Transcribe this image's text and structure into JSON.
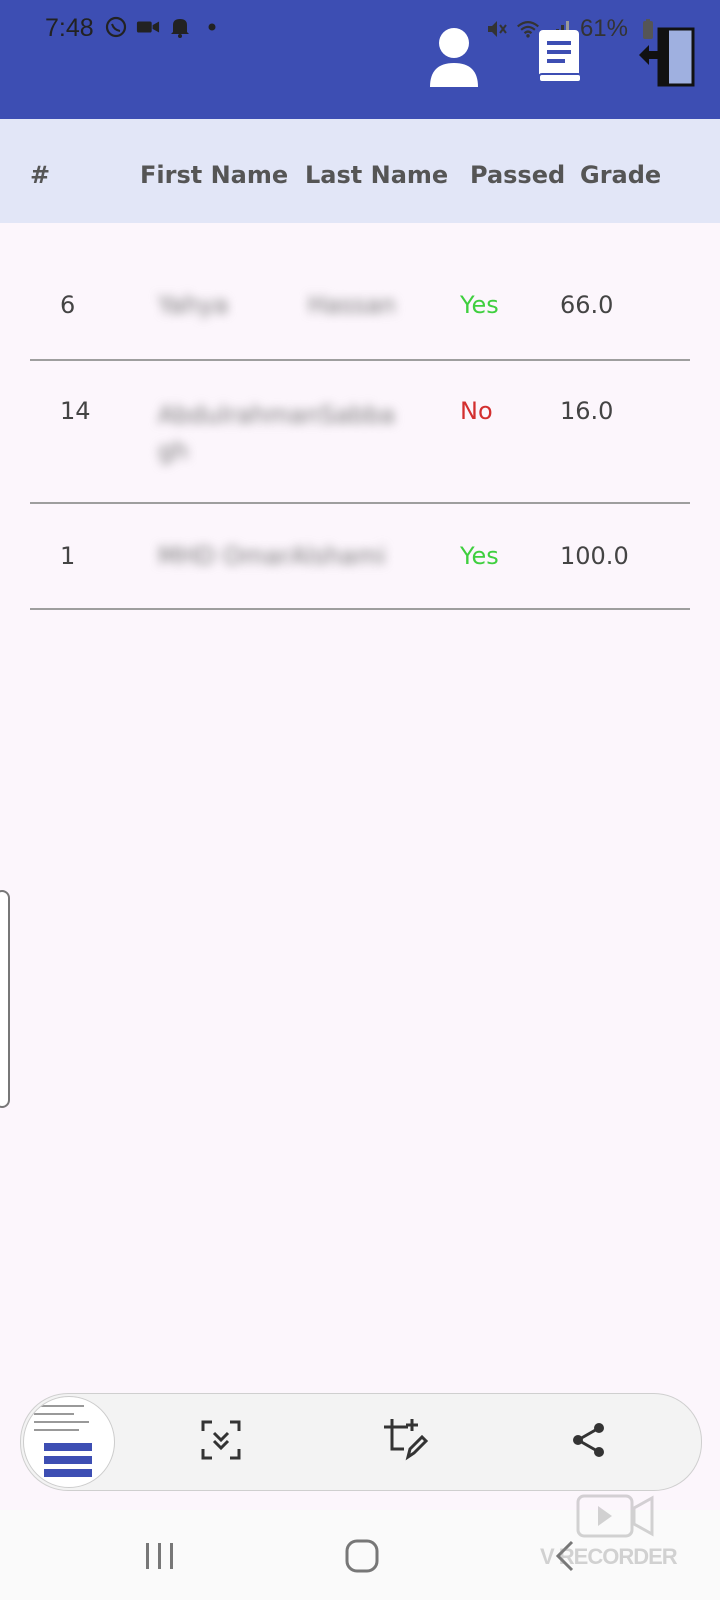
{
  "status_bar": {
    "time": "7:48",
    "battery": "61%"
  },
  "header": {
    "icons": [
      "person-icon",
      "book-icon",
      "logout-icon"
    ]
  },
  "table": {
    "columns": [
      "#",
      "First Name",
      "Last Name",
      "Passed",
      "Grade"
    ],
    "rows": [
      {
        "id": "6",
        "first_name": "Yahya",
        "last_name": "Hassan",
        "passed": "Yes",
        "grade": "66.0"
      },
      {
        "id": "14",
        "first_name": "Abdulrahman",
        "last_name": "Sabbagh",
        "passed": "No",
        "grade": "16.0"
      },
      {
        "id": "1",
        "first_name": "MHD Omar",
        "last_name": "Alshami",
        "passed": "Yes",
        "grade": "100.0"
      }
    ]
  },
  "screenshot_toolbar": {
    "buttons": [
      "scroll-capture-icon",
      "crop-edit-icon",
      "share-icon"
    ]
  },
  "watermark": {
    "text": "V RECORDER"
  },
  "colors": {
    "appbar": "#3d4eb3",
    "table_header": "#e2e6f7",
    "passed_yes": "#3fcf3f",
    "passed_no": "#d32f2f",
    "background": "#fcf6fc"
  }
}
